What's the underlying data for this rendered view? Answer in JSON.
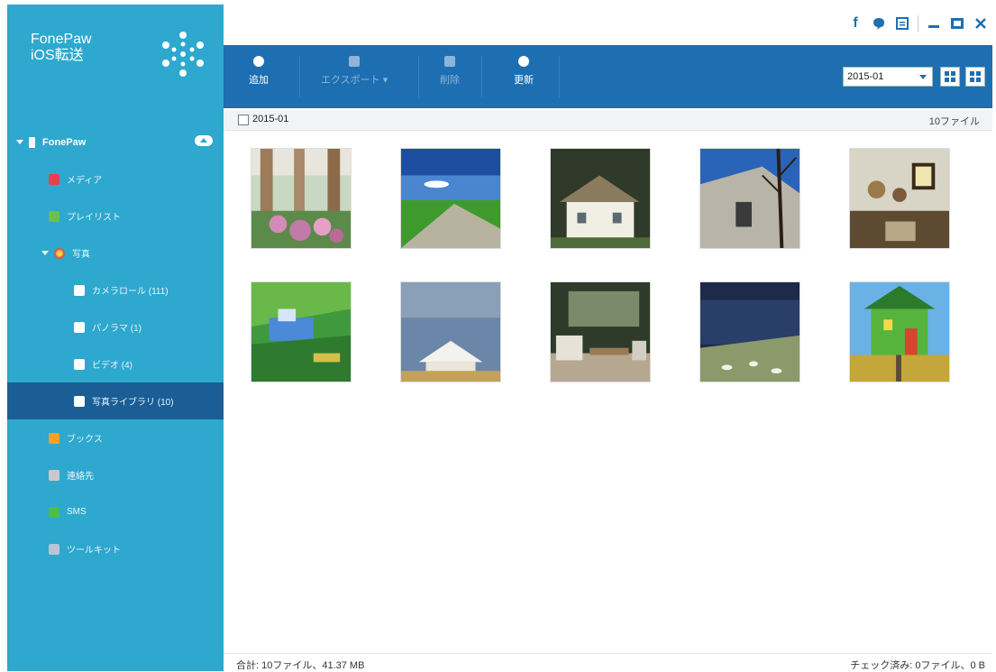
{
  "app": {
    "name_line1": "FonePaw",
    "name_line2": "iOS転送"
  },
  "sidebar": {
    "device": {
      "label": "FonePaw"
    },
    "items": [
      {
        "label": "メディア",
        "color": "#e8404f"
      },
      {
        "label": "プレイリスト",
        "color": "#6cc04a"
      },
      {
        "label": "写真",
        "color": "#f29a2e"
      },
      {
        "label": "カメラロール (111)",
        "color": "#ffffff"
      },
      {
        "label": "パノラマ (1)",
        "color": "#ffffff"
      },
      {
        "label": "ビデオ (4)",
        "color": "#ffffff"
      },
      {
        "label": "写真ライブラリ (10)",
        "color": "#ffffff"
      },
      {
        "label": "ブックス",
        "color": "#f7a024"
      },
      {
        "label": "連絡先",
        "color": "#c9c9c9"
      },
      {
        "label": "SMS",
        "color": "#49c04a"
      },
      {
        "label": "ツールキット",
        "color": "#b9c4d8"
      }
    ]
  },
  "toolbar": {
    "add": "追加",
    "export": "エクスポート ▾",
    "delete": "削除",
    "refresh": "更新",
    "date_select": "2015-01"
  },
  "group": {
    "title": "2015-01",
    "count": "10ファイル"
  },
  "status": {
    "total": "合計:  10ファイル、41.37 MB",
    "checked": "チェック済み: 0ファイル、0 B"
  },
  "photos": [
    {
      "name": "photo-gazebo-flowers"
    },
    {
      "name": "photo-green-field-road"
    },
    {
      "name": "photo-thatched-cottage"
    },
    {
      "name": "photo-old-house-tree"
    },
    {
      "name": "photo-kitchen-wall"
    },
    {
      "name": "photo-village-aerial"
    },
    {
      "name": "photo-white-house-sky"
    },
    {
      "name": "photo-patio-furniture"
    },
    {
      "name": "photo-lake-sheep"
    },
    {
      "name": "photo-green-house-birdhouse"
    }
  ]
}
